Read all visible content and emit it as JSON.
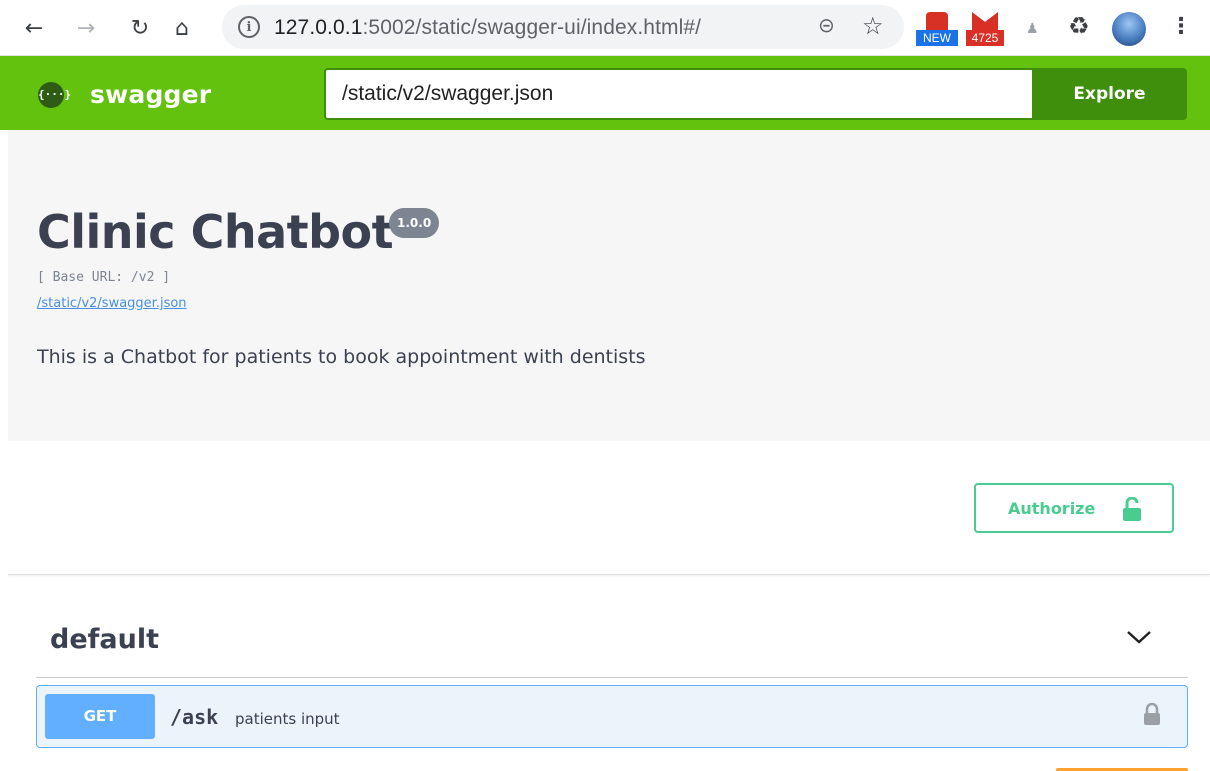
{
  "browser": {
    "url_host": "127.0.0.1",
    "url_rest": ":5002/static/swagger-ui/index.html#/",
    "ext_new_label": "NEW",
    "ext_mail_count": "4725",
    "icons": [
      "back-arrow-icon",
      "forward-arrow-icon",
      "reload-icon",
      "home-icon",
      "info-icon",
      "zoom-icon",
      "star-icon",
      "puzzle-icon",
      "menu-icon"
    ]
  },
  "topbar": {
    "logo_text": "swagger",
    "logo_mark": "{···}",
    "spec_url": "/static/v2/swagger.json",
    "explore_label": "Explore"
  },
  "info": {
    "title": "Clinic Chatbot",
    "version": "1.0.0",
    "base_url": "[ Base URL: /v2 ]",
    "spec_link": "/static/v2/swagger.json",
    "description": "This is a Chatbot for patients to book appointment with dentists"
  },
  "auth": {
    "label": "Authorize"
  },
  "tags": [
    {
      "name": "default",
      "operations": [
        {
          "method": "GET",
          "path": "/ask",
          "summary": "patients input"
        }
      ]
    }
  ],
  "colors": {
    "topbar": "#62c20d",
    "explore": "#3f8e0c",
    "get": "#61affe",
    "authorize": "#49cc90",
    "text": "#3b4151"
  }
}
